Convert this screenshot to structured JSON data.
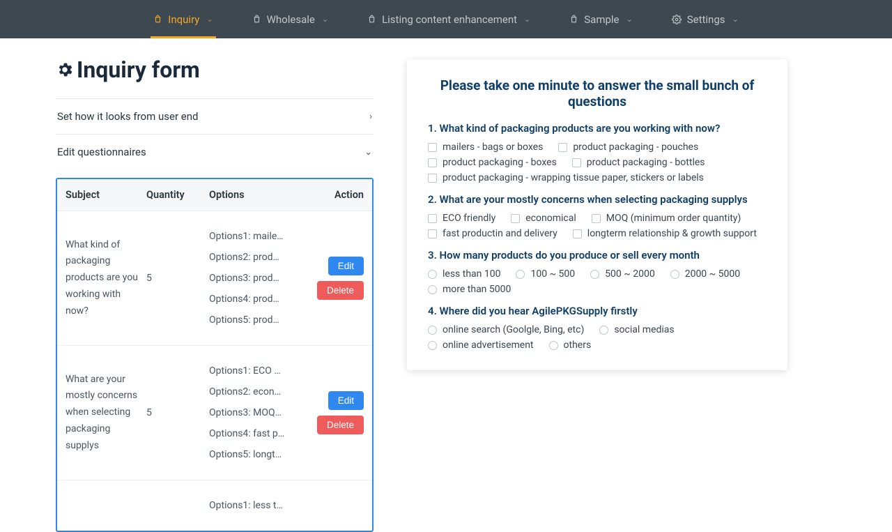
{
  "nav": {
    "items": [
      {
        "label": "Inquiry",
        "active": true,
        "icon": "bag"
      },
      {
        "label": "Wholesale",
        "active": false,
        "icon": "bag"
      },
      {
        "label": "Listing content enhancement",
        "active": false,
        "icon": "bag"
      },
      {
        "label": "Sample",
        "active": false,
        "icon": "bag"
      },
      {
        "label": "Settings",
        "active": false,
        "icon": "gear"
      }
    ]
  },
  "page": {
    "title": "Inquiry form"
  },
  "accordion": {
    "preview_label": "Set how it looks from user end",
    "edit_label": "Edit questionnaires"
  },
  "table": {
    "headers": {
      "subject": "Subject",
      "quantity": "Quantity",
      "options": "Options",
      "action": "Action"
    },
    "buttons": {
      "edit": "Edit",
      "delete": "Delete"
    },
    "rows": [
      {
        "subject": "What kind of packaging products are you working with now?",
        "quantity": "5",
        "options": [
          "Options1: maile…",
          "Options2: prod…",
          "Options3: prod…",
          "Options4: prod…",
          "Options5: prod…"
        ]
      },
      {
        "subject": "What are your mostly concerns when selecting packaging supplys",
        "quantity": "5",
        "options": [
          "Options1: ECO …",
          "Options2: econ…",
          "Options3: MOQ…",
          "Options4: fast p…",
          "Options5: longt…"
        ]
      },
      {
        "subject": "",
        "quantity": "",
        "options": [
          "Options1: less t…"
        ]
      }
    ]
  },
  "preview": {
    "heading": "Please take one minute to answer the small bunch of questions",
    "questions": [
      {
        "num": "1.",
        "text": "What kind of packaging products are you working with now?",
        "type": "checkbox",
        "options": [
          "mailers - bags or boxes",
          "product packaging - pouches",
          "product packaging - boxes",
          "product packaging - bottles",
          "product packaging - wrapping tissue paper, stickers or labels"
        ]
      },
      {
        "num": "2.",
        "text": "What are your mostly concerns when selecting packaging supplys",
        "type": "checkbox",
        "options": [
          "ECO friendly",
          "economical",
          "MOQ (minimum order quantity)",
          "fast productin and delivery",
          "longterm relationship & growth support"
        ]
      },
      {
        "num": "3.",
        "text": "How many products do you produce or sell every month",
        "type": "radio",
        "options": [
          "less than 100",
          "100 ~ 500",
          "500 ~ 2000",
          "2000 ~ 5000",
          "more than 5000"
        ]
      },
      {
        "num": "4.",
        "text": "Where did you hear AgilePKGSupply firstly",
        "type": "radio",
        "options": [
          "online search (Goolgle, Bing, etc)",
          "social medias",
          "online advertisement",
          "others"
        ]
      }
    ]
  }
}
